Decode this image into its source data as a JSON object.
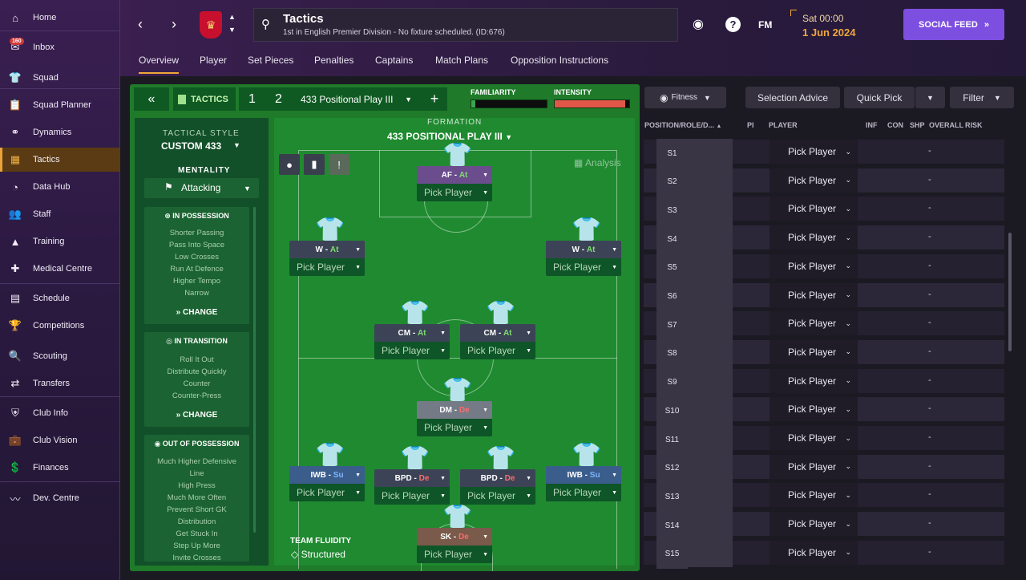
{
  "sidebar": {
    "items": [
      {
        "label": "Home",
        "icon": "home-icon",
        "glyph": "⌂"
      },
      {
        "label": "Inbox",
        "icon": "inbox-icon",
        "glyph": "✉",
        "badge": "160"
      },
      {
        "label": "Squad",
        "icon": "squad-icon",
        "glyph": "👕"
      },
      {
        "label": "Squad Planner",
        "icon": "planner-icon",
        "glyph": "📋"
      },
      {
        "label": "Dynamics",
        "icon": "dynamics-icon",
        "glyph": "⚭"
      },
      {
        "label": "Tactics",
        "icon": "tactics-icon",
        "glyph": "▦",
        "active": true
      },
      {
        "label": "Data Hub",
        "icon": "data-hub-icon",
        "glyph": "◔"
      },
      {
        "label": "Staff",
        "icon": "staff-icon",
        "glyph": "👥"
      },
      {
        "label": "Training",
        "icon": "training-icon",
        "glyph": "▲"
      },
      {
        "label": "Medical Centre",
        "icon": "medical-icon",
        "glyph": "✚"
      },
      {
        "label": "Schedule",
        "icon": "schedule-icon",
        "glyph": "▤"
      },
      {
        "label": "Competitions",
        "icon": "trophy-icon",
        "glyph": "🏆"
      },
      {
        "label": "Scouting",
        "icon": "scouting-icon",
        "glyph": "🔍"
      },
      {
        "label": "Transfers",
        "icon": "transfers-icon",
        "glyph": "⇄"
      },
      {
        "label": "Club Info",
        "icon": "club-info-icon",
        "glyph": "⛨"
      },
      {
        "label": "Club Vision",
        "icon": "club-vision-icon",
        "glyph": "💼"
      },
      {
        "label": "Finances",
        "icon": "finances-icon",
        "glyph": "💲"
      },
      {
        "label": "Dev. Centre",
        "icon": "dev-centre-icon",
        "glyph": "〰"
      }
    ]
  },
  "header": {
    "title": "Tactics",
    "subtitle": "1st in English Premier Division - No fixture scheduled. (ID:676)",
    "day": "Sat 00:00",
    "date": "1 Jun 2024",
    "fm_label": "FM",
    "social_label": "SOCIAL FEED",
    "tabs": [
      "Overview",
      "Player",
      "Set Pieces",
      "Penalties",
      "Captains",
      "Match Plans",
      "Opposition Instructions"
    ]
  },
  "toolbar": {
    "tactics_label": "TACTICS",
    "slot1": "1",
    "slot2": "2",
    "tactic_name": "433 Positional Play III",
    "familiarity_label": "FAMILIARITY",
    "intensity_label": "INTENSITY",
    "familiarity_level": 0.05,
    "intensity_level": 0.95
  },
  "style": {
    "tactical_style_label": "TACTICAL STYLE",
    "tactical_style": "CUSTOM 433",
    "mentality_label": "MENTALITY",
    "mentality": "Attacking",
    "in_possession_title": "IN POSSESSION",
    "in_possession": [
      "Shorter Passing",
      "Pass Into Space",
      "Low Crosses",
      "Run At Defence",
      "Higher Tempo",
      "Narrow"
    ],
    "in_transition_title": "IN TRANSITION",
    "in_transition": [
      "Roll It Out",
      "Distribute Quickly",
      "Counter",
      "Counter-Press"
    ],
    "out_possession_title": "OUT OF POSSESSION",
    "out_possession": [
      "Much Higher Defensive",
      "Line",
      "High Press",
      "Much More Often",
      "Prevent Short GK",
      "Distribution",
      "Get Stuck In",
      "Step Up More",
      "Invite Crosses"
    ],
    "change_label": "CHANGE"
  },
  "pitch": {
    "formation_label": "FORMATION",
    "formation": "433 POSITIONAL PLAY III",
    "analysis_label": "Analysis",
    "fluidity_label": "TEAM FLUIDITY",
    "fluidity": "Structured",
    "positions": [
      {
        "role": "AF",
        "duty": "At",
        "duty_color": "#7dde6f",
        "kind": "af"
      },
      {
        "role": "W",
        "duty": "At",
        "duty_color": "#7dde6f",
        "kind": "n"
      },
      {
        "role": "W",
        "duty": "At",
        "duty_color": "#7dde6f",
        "kind": "n"
      },
      {
        "role": "CM",
        "duty": "At",
        "duty_color": "#7dde6f",
        "kind": "n"
      },
      {
        "role": "CM",
        "duty": "At",
        "duty_color": "#7dde6f",
        "kind": "n"
      },
      {
        "role": "DM",
        "duty": "De",
        "duty_color": "#ff6b6b",
        "kind": "dm"
      },
      {
        "role": "IWB",
        "duty": "Su",
        "duty_color": "#7fb6ff",
        "kind": "su"
      },
      {
        "role": "BPD",
        "duty": "De",
        "duty_color": "#ff6b6b",
        "kind": "n"
      },
      {
        "role": "BPD",
        "duty": "De",
        "duty_color": "#ff6b6b",
        "kind": "n"
      },
      {
        "role": "IWB",
        "duty": "Su",
        "duty_color": "#7fb6ff",
        "kind": "su"
      },
      {
        "role": "SK",
        "duty": "De",
        "duty_color": "#ff6b6b",
        "kind": "gk"
      }
    ],
    "pick_label": "Pick Player"
  },
  "selection": {
    "fitness_label": "Fitness",
    "selection_advice_label": "Selection Advice",
    "quick_pick_label": "Quick Pick",
    "filter_label": "Filter",
    "columns": [
      "POSITION/ROLE/D...",
      "PI",
      "PLAYER",
      "INF",
      "CON",
      "SHP",
      "OVERALL",
      "RISK"
    ],
    "rows": [
      {
        "pos": "S1",
        "player": "Pick Player",
        "risk": "-"
      },
      {
        "pos": "S2",
        "player": "Pick Player",
        "risk": "-"
      },
      {
        "pos": "S3",
        "player": "Pick Player",
        "risk": "-"
      },
      {
        "pos": "S4",
        "player": "Pick Player",
        "risk": "-"
      },
      {
        "pos": "S5",
        "player": "Pick Player",
        "risk": "-"
      },
      {
        "pos": "S6",
        "player": "Pick Player",
        "risk": "-"
      },
      {
        "pos": "S7",
        "player": "Pick Player",
        "risk": "-"
      },
      {
        "pos": "S8",
        "player": "Pick Player",
        "risk": "-"
      },
      {
        "pos": "S9",
        "player": "Pick Player",
        "risk": "-"
      },
      {
        "pos": "S10",
        "player": "Pick Player",
        "risk": "-"
      },
      {
        "pos": "S11",
        "player": "Pick Player",
        "risk": "-"
      },
      {
        "pos": "S12",
        "player": "Pick Player",
        "risk": "-"
      },
      {
        "pos": "S13",
        "player": "Pick Player",
        "risk": "-"
      },
      {
        "pos": "S14",
        "player": "Pick Player",
        "risk": "-"
      },
      {
        "pos": "S15",
        "player": "Pick Player",
        "risk": "-"
      }
    ]
  },
  "colors": {
    "accent": "#f0a73a",
    "social": "#7d4fe0",
    "pitch": "#1f8a30",
    "panel": "#1f7a2a"
  }
}
